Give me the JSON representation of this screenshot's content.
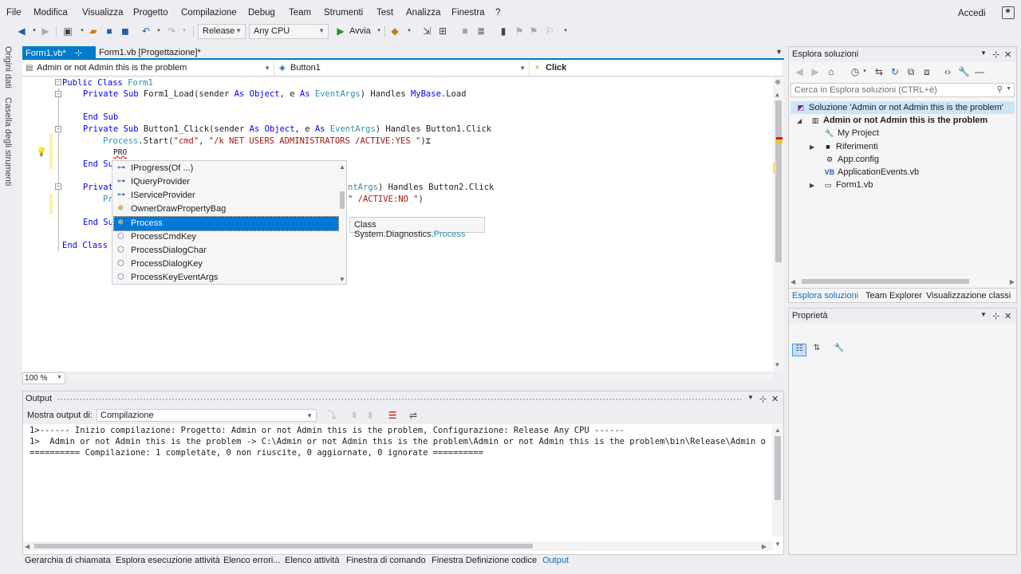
{
  "menu": {
    "items": [
      "File",
      "Modifica",
      "Visualizza",
      "Progetto",
      "Compilazione",
      "Debug",
      "Team",
      "Strumenti",
      "Test",
      "Analizza",
      "Finestra",
      "?"
    ],
    "sign_in": "Accedi"
  },
  "toolbar": {
    "configuration": "Release",
    "platform": "Any CPU",
    "start_label": "Avvia"
  },
  "left_strip": {
    "data_sources": "Origini dati",
    "toolbox": "Casella degli strumenti"
  },
  "doc_tabs": [
    {
      "label": "Form1.vb*",
      "pin": "⊹",
      "close": "✕"
    },
    {
      "label": "Form1.vb [Progettazione]*"
    }
  ],
  "navbar": {
    "project": "Admin or not Admin this is the problem",
    "object": "Button1",
    "event": "Click"
  },
  "code": {
    "l1_kw": "Public Class",
    "l1_name": " Form1",
    "l2_kw1": "Private Sub",
    "l2_name": " Form1_Load(sender ",
    "l2_kw2": "As",
    "l2_t1": " Object",
    "l2_sep": ", e ",
    "l2_kw3": "As",
    "l2_t2": " EventArgs",
    "l2_h": ") Handles ",
    "l2_t3": "MyBase",
    "l2_end": ".Load",
    "l3": "End Sub",
    "l4_kw1": "Private Sub",
    "l4_name": " Button1_Click(sender ",
    "l4_kw2": "As",
    "l4_t1": " Object",
    "l4_sep": ", e ",
    "l4_kw3": "As",
    "l4_t2": " EventArgs",
    "l4_h": ") Handles Button1.Click",
    "l5_t": "Process",
    "l5_mid": ".Start(",
    "l5_s1": "\"cmd\"",
    "l5_c": ", ",
    "l5_s2": "\"/k NET USERS ADMINISTRATORS /ACTIVE:YES \"",
    "l5_end": ")",
    "l6": "PRO",
    "l7": "End Su",
    "l8": "Privat",
    "l9": "Pr",
    "l10": "End Su",
    "l11_kw": "End Class",
    "l8_tail_t": "ntArgs",
    "l8_tail": ") Handles Button2.Click",
    "l9_tail_s": "\" /ACTIVE:NO \"",
    "l9_tail": ")"
  },
  "intellisense": {
    "items": [
      {
        "label": "IProgress(Of ...)",
        "icon": "interface-icon"
      },
      {
        "label": "IQueryProvider",
        "icon": "interface-icon"
      },
      {
        "label": "IServiceProvider",
        "icon": "interface-icon"
      },
      {
        "label": "OwnerDrawPropertyBag",
        "icon": "class-icon"
      },
      {
        "label": "Process",
        "icon": "class-icon"
      },
      {
        "label": "ProcessCmdKey",
        "icon": "method-icon"
      },
      {
        "label": "ProcessDialogChar",
        "icon": "method-icon"
      },
      {
        "label": "ProcessDialogKey",
        "icon": "method-icon"
      },
      {
        "label": "ProcessKeyEventArgs",
        "icon": "method-icon"
      }
    ],
    "selected_index": 4,
    "tooltip_prefix": "Class System.Diagnostics.",
    "tooltip_type": "Process"
  },
  "zoom": "100 %",
  "output": {
    "title": "Output",
    "source_label": "Mostra output di:",
    "source_value": "Compilazione",
    "lines": [
      "1>------ Inizio compilazione: Progetto: Admin or not Admin this is the problem, Configurazione: Release Any CPU ------",
      "1>  Admin or not Admin this is the problem -> C:\\Admin or not Admin this is the problem\\Admin or not Admin this is the problem\\bin\\Release\\Admin o",
      "========== Compilazione: 1 completate, 0 non riuscite, 0 aggiornate, 0 ignorate =========="
    ]
  },
  "bottom_tabs": [
    "Gerarchia di chiamata",
    "Esplora esecuzione attività",
    "Elenco errori...",
    "Elenco attività",
    "Finestra di comando",
    "Finestra Definizione codice",
    "Output"
  ],
  "solution_explorer": {
    "title": "Esplora soluzioni",
    "search_placeholder": "Cerca in Esplora soluzioni (CTRL+è)",
    "root": "Soluzione 'Admin or not Admin this is the problem'",
    "project": "Admin or not Admin this is the problem",
    "children": [
      "My Project",
      "Riferimenti",
      "App.config",
      "ApplicationEvents.vb",
      "Form1.vb"
    ],
    "tabs": [
      "Esplora soluzioni",
      "Team Explorer",
      "Visualizzazione classi"
    ]
  },
  "properties": {
    "title": "Proprietà"
  },
  "colors": {
    "accent": "#007acc",
    "selection": "#0078d7",
    "keyword": "#0000ff",
    "type": "#2b91af",
    "string": "#a31515"
  }
}
